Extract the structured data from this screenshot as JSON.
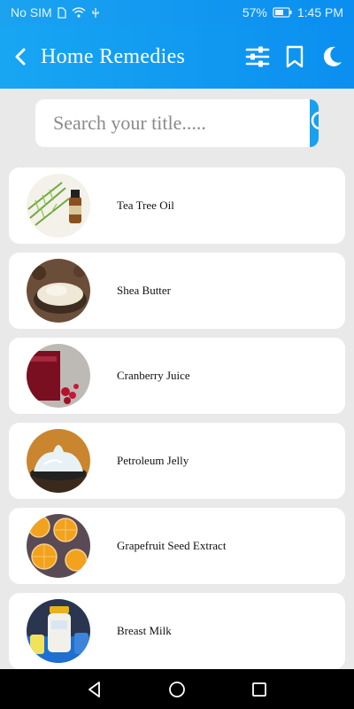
{
  "status": {
    "carrier": "No SIM",
    "battery": "57%",
    "time": "1:45 PM"
  },
  "appbar": {
    "title": "Home Remedies",
    "icons": [
      "back-arrow-icon",
      "filter-sliders-icon",
      "bookmark-icon",
      "moon-icon"
    ]
  },
  "search": {
    "placeholder": "Search your title.....",
    "value": ""
  },
  "remedies": [
    {
      "title": "Tea Tree Oil"
    },
    {
      "title": "Shea Butter"
    },
    {
      "title": "Cranberry Juice"
    },
    {
      "title": "Petroleum Jelly"
    },
    {
      "title": "Grapefruit Seed Extract"
    },
    {
      "title": "Breast Milk"
    }
  ],
  "colors": {
    "primary": "#0b8ff0",
    "background": "#e9e9e9",
    "card": "#ffffff",
    "navbar": "#000000"
  }
}
